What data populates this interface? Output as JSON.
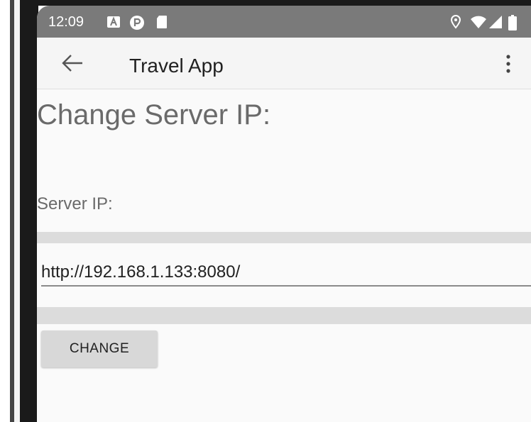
{
  "status_bar": {
    "time": "12:09",
    "icons": [
      "a-badge-icon",
      "p-badge-icon",
      "sd-card-icon",
      "location-icon",
      "wifi-icon",
      "cell-signal-icon",
      "battery-icon"
    ]
  },
  "app_bar": {
    "title": "Travel App",
    "back_icon": "arrow-left-icon",
    "menu_icon": "more-vert-icon"
  },
  "main": {
    "heading": "Change Server IP:",
    "field_label": "Server IP:",
    "ip_value": "http://192.168.1.133:8080/",
    "button_label": "CHANGE"
  },
  "colors": {
    "status_bar": "#7a7a7a",
    "app_bar": "#f5f5f5",
    "background": "#fafafa",
    "band": "#dcdcdc",
    "button": "#d8d8d8"
  }
}
